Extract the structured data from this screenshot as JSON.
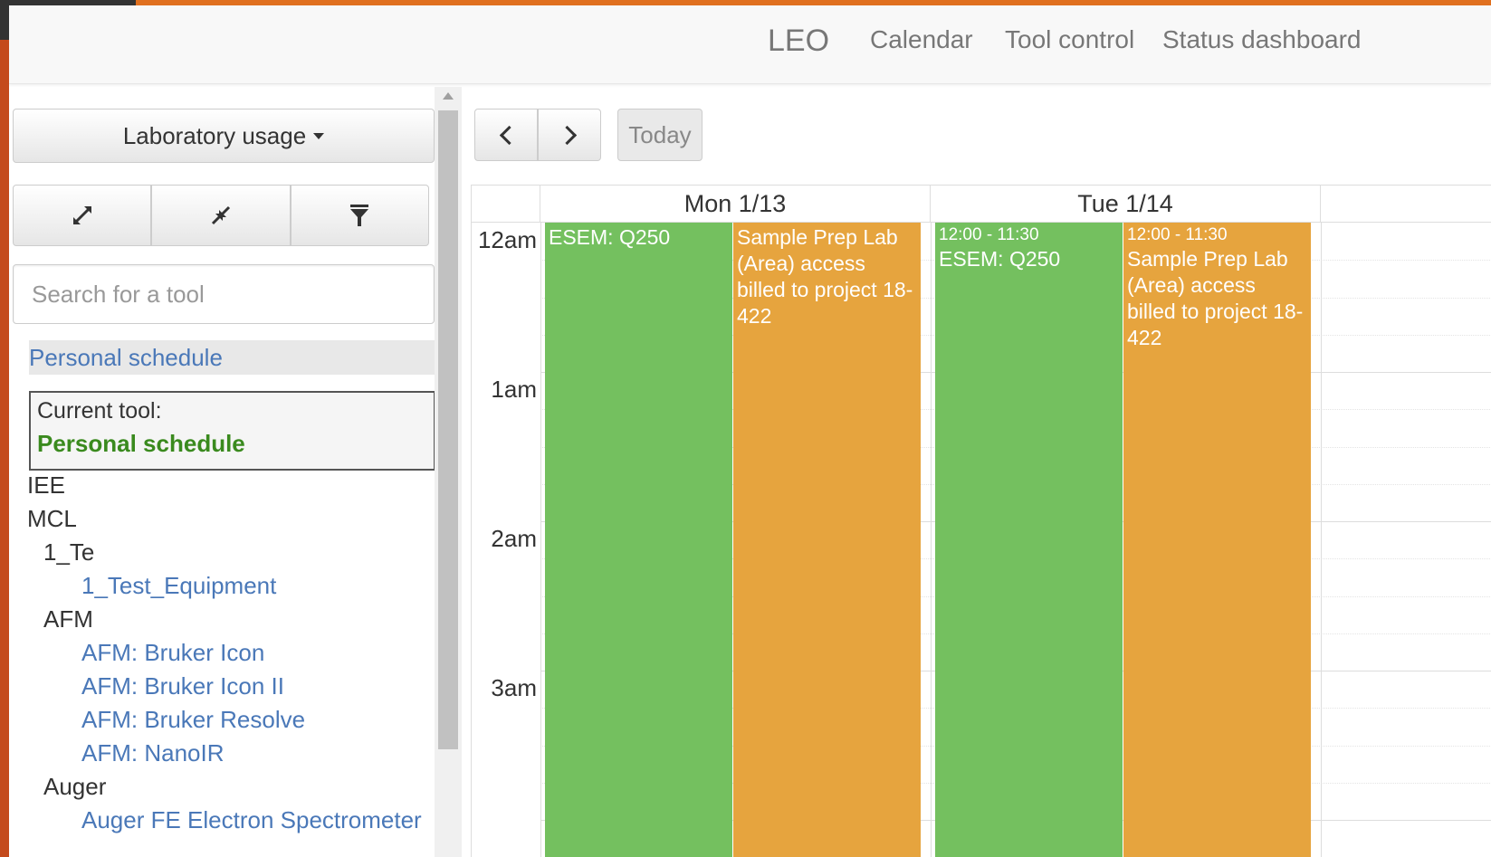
{
  "nav": {
    "brand": "LEO",
    "items": [
      "Calendar",
      "Tool control",
      "Status dashboard"
    ]
  },
  "sidebar": {
    "dropdown_label": "Laboratory usage",
    "expand_icon": "expand-icon",
    "collapse_icon": "collapse-icon",
    "filter_icon": "filter-icon",
    "search_placeholder": "Search for a tool",
    "personal_schedule_link": "Personal schedule",
    "current_tool_label": "Current tool:",
    "current_tool_value": "Personal schedule",
    "tree": [
      {
        "text": "IEE",
        "kind": "category",
        "level": 0
      },
      {
        "text": "MCL",
        "kind": "category",
        "level": 0
      },
      {
        "text": "1_Te",
        "kind": "category",
        "level": 1
      },
      {
        "text": "1_Test_Equipment",
        "kind": "tool",
        "level": 2
      },
      {
        "text": "AFM",
        "kind": "category",
        "level": 1
      },
      {
        "text": "AFM: Bruker Icon",
        "kind": "tool",
        "level": 2
      },
      {
        "text": "AFM: Bruker Icon II",
        "kind": "tool",
        "level": 2
      },
      {
        "text": "AFM: Bruker Resolve",
        "kind": "tool",
        "level": 2
      },
      {
        "text": "AFM: NanoIR",
        "kind": "tool",
        "level": 2
      },
      {
        "text": "Auger",
        "kind": "category",
        "level": 1
      },
      {
        "text": "Auger FE Electron Spectrometer",
        "kind": "tool",
        "level": 2
      }
    ]
  },
  "calendar": {
    "prev_icon": "chevron-left-icon",
    "next_icon": "chevron-right-icon",
    "today_label": "Today",
    "days": [
      {
        "header": "Mon 1/13",
        "events": [
          {
            "time": "",
            "title": "ESEM: Q250",
            "color": "#74c05f"
          },
          {
            "time": "",
            "title": "Sample Prep Lab (Area) access billed to project 18-422",
            "color": "#e6a43e"
          }
        ]
      },
      {
        "header": "Tue 1/14",
        "events": [
          {
            "time": "12:00 - 11:30",
            "title": "ESEM: Q250",
            "color": "#74c05f"
          },
          {
            "time": "12:00 - 11:30",
            "title": "Sample Prep Lab (Area) access billed to project 18-422",
            "color": "#e6a43e"
          }
        ]
      }
    ],
    "hours": [
      "12am",
      "1am",
      "2am",
      "3am"
    ]
  },
  "colors": {
    "accent": "#e0701f",
    "link": "#4a78b8",
    "current_tool": "#3a8a1e",
    "event_green": "#74c05f",
    "event_orange": "#e6a43e"
  }
}
